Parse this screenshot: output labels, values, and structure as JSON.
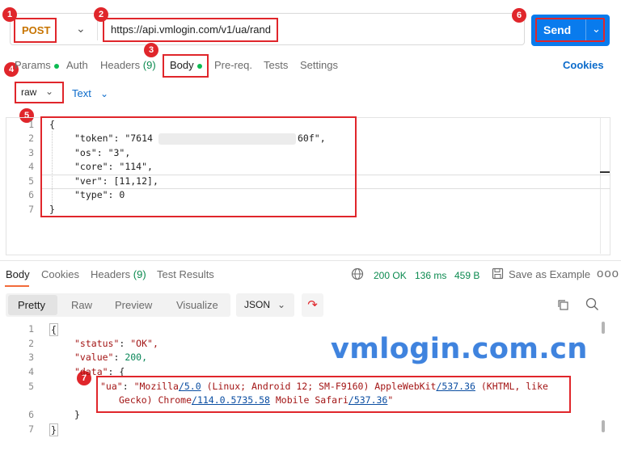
{
  "request": {
    "method": "POST",
    "url": "https://api.vmlogin.com/v1/ua/rand",
    "send_label": "Send"
  },
  "markers": [
    "1",
    "2",
    "3",
    "4",
    "5",
    "6",
    "7"
  ],
  "request_tabs": [
    {
      "label": "Params",
      "dot": true
    },
    {
      "label": "Auth"
    },
    {
      "label": "Headers",
      "count": "(9)"
    },
    {
      "label": "Body",
      "dot": true
    },
    {
      "label": "Pre-req."
    },
    {
      "label": "Tests"
    },
    {
      "label": "Settings"
    }
  ],
  "cookies_link": "Cookies",
  "body_mode": "raw",
  "body_language": "Text",
  "request_body": {
    "line_numbers": [
      "1",
      "2",
      "3",
      "4",
      "5",
      "6",
      "7"
    ],
    "open": "{",
    "token_key": "\"token\"",
    "token_head": "\"7614",
    "token_tail": "60f\",",
    "os_key": "\"os\"",
    "os_val": "\"3\",",
    "core_key": "\"core\"",
    "core_val": "\"114\",",
    "ver_key": "\"ver\"",
    "ver_val": "[11,12],",
    "type_key": "\"type\"",
    "type_val": "0",
    "close": "}"
  },
  "response_tabs": [
    {
      "label": "Body",
      "active": true
    },
    {
      "label": "Cookies"
    },
    {
      "label": "Headers",
      "count": "(9)"
    },
    {
      "label": "Test Results"
    }
  ],
  "response_status": {
    "status": "200 OK",
    "time": "136 ms",
    "size": "459 B",
    "save_label": "Save as Example",
    "more": "ooo"
  },
  "format_tabs": [
    "Pretty",
    "Raw",
    "Preview",
    "Visualize"
  ],
  "format_select": "JSON",
  "response_body": {
    "line_numbers": [
      "1",
      "2",
      "3",
      "4",
      "5",
      "6",
      "7"
    ],
    "open": "{",
    "status_key": "\"status\"",
    "status_val": "\"OK\",",
    "value_key": "\"value\"",
    "value_val": "200,",
    "data_key": "\"data\"",
    "data_open": "{",
    "ua_key": "\"ua\"",
    "ua_1a": "\"Mozilla",
    "ua_1b": "/5.0",
    "ua_1c": " (Linux; Android 12; SM-F9160) AppleWebKit",
    "ua_1d": "/537.36",
    "ua_1e": " (KHTML, like",
    "ua_2a": "Gecko) Chrome",
    "ua_2b": "/114.0.5735.58",
    "ua_2c": " Mobile Safari",
    "ua_2d": "/537.36",
    "ua_2e": "\"",
    "data_close": "}",
    "close": "}"
  },
  "watermark": "vmlogin.com.cn",
  "colors": {
    "send_blue": "#097bed",
    "annotation_red": "#e0262b",
    "method_orange": "#c77400",
    "status_green": "#0b8a4f",
    "link_blue": "#0b6bcb"
  }
}
